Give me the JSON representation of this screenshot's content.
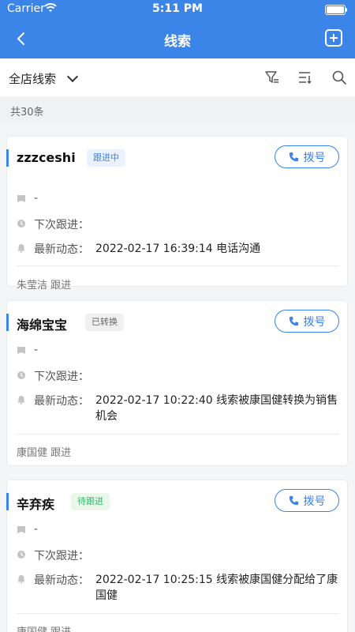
{
  "status_bar": {
    "carrier": "Carrier",
    "time": "5:11 PM"
  },
  "nav": {
    "title": "线索"
  },
  "filter": {
    "store_label": "全店线索"
  },
  "summary": {
    "count_text": "共30条"
  },
  "dial_label": "拨号",
  "leads": [
    {
      "name": "zzzceshi",
      "status": "跟进中",
      "status_color": "#3b84e8",
      "note": "-",
      "next_follow_label": "下次跟进：",
      "next_follow_value": "",
      "latest_label": "最新动态：",
      "latest_value": "2022-02-17 16:39:14 电话沟通",
      "follower": "朱莹洁 跟进"
    },
    {
      "name": "海绵宝宝",
      "status": "已转换",
      "status_color": "#666666",
      "note": "-",
      "next_follow_label": "下次跟进：",
      "next_follow_value": "",
      "latest_label": "最新动态：",
      "latest_value": "2022-02-17 10:22:40 线索被康国健转换为销售机会",
      "follower": "康国健 跟进"
    },
    {
      "name": "辛弃疾",
      "status": "待跟进",
      "status_color": "#3cb371",
      "note": "-",
      "next_follow_label": "下次跟进：",
      "next_follow_value": "",
      "latest_label": "最新动态：",
      "latest_value": "2022-02-17 10:25:15 线索被康国健分配给了康国健",
      "follower": "康国健 跟进"
    }
  ]
}
